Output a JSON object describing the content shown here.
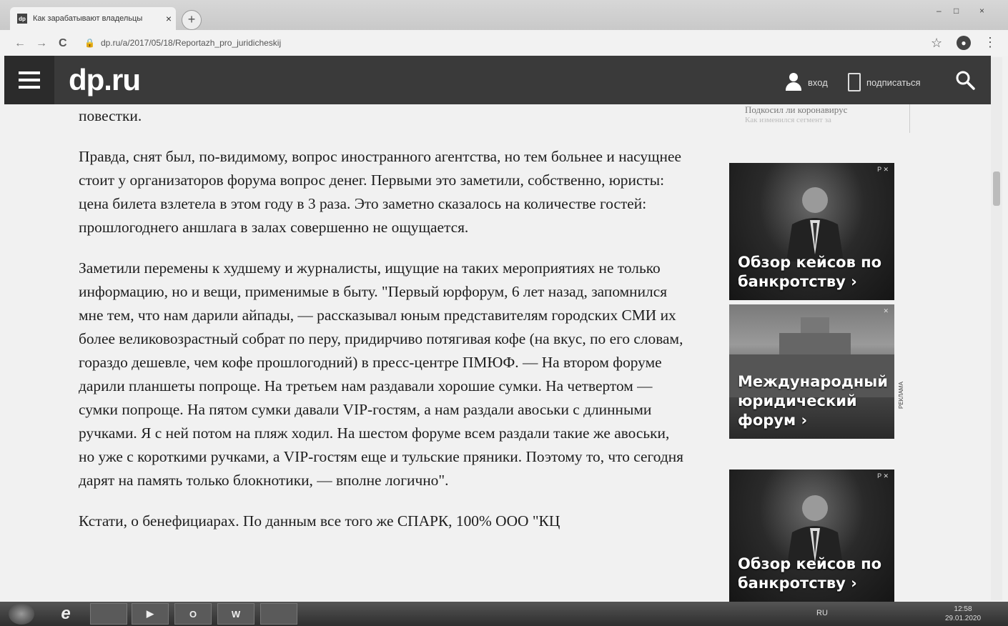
{
  "browser": {
    "tab_favicon": "dp",
    "tab_title": "Как зарабатывают владельцы",
    "tab_close": "×",
    "new_tab": "+",
    "url": "dp.ru/a/2017/05/18/Reportazh_pro_juridicheskij",
    "back": "←",
    "forward": "→",
    "reload": "C",
    "lock": "🔒",
    "star": "☆",
    "profile": "●",
    "menu": "⋮",
    "minimize": "–",
    "maximize": "□",
    "close": "×"
  },
  "site": {
    "logo": "dp.ru",
    "login": "вход",
    "subscribe": "подписаться"
  },
  "article": {
    "paragraphs": [
      "повестки.",
      "Правда, снят был, по-видимому, вопрос иностранного агентства, но тем больнее и насущнее стоит у организаторов форума вопрос денег. Первыми это заметили, собственно, юристы: цена билета взлетела в этом году в 3 раза. Это заметно сказалось на количестве гостей: прошлогоднего аншлага в залах совершенно не ощущается.",
      "Заметили перемены к худшему и журналисты, ищущие на таких мероприятиях не только информацию, но и вещи, применимые в быту. \"Первый юрфорум, 6 лет назад, запомнился мне тем, что нам дарили айпады, — рассказывал юным представителям городских СМИ их более великовозрастный собрат по перу, придирчиво потягивая кофе (на вкус, по его словам, гораздо дешевле, чем кофе прошлогодний) в пресс-центре ПМЮФ. — На втором форуме дарили планшеты попроще. На третьем нам раздавали хорошие сумки. На четвертом — сумки попроще. На пятом сумки давали VIP-гостям, а нам раздали авоськи с длинными ручками. Я с ней потом на пляж ходил. На шестом форуме всем раздали такие же авоськи, но уже с короткими ручками, а VIP-гостям еще и тульские пряники. Поэтому то, что сегодня дарят на память только блокнотики, — вполне логично\".",
      "Кстати, о бенефициарах. По данным все того же СПАРК, 100% ООО \"КЦ"
    ]
  },
  "sidebar": {
    "top_title": "Подкосил ли коронавирус",
    "top_sub": "Как изменился сегмент за",
    "ads": [
      {
        "label": "Обзор кейсов по банкротству ›",
        "mark": "P ✕"
      },
      {
        "label": "Международный юридический форум ›",
        "mark": "✕"
      },
      {
        "label": "Обзор кейсов по банкротству ›",
        "mark": "P ✕"
      }
    ],
    "reklama": "РЕКЛАМА"
  },
  "taskbar": {
    "apps": [
      "e",
      "",
      "▶",
      "O",
      "W",
      ""
    ],
    "lang": "RU",
    "time": "12:58",
    "date": "29.01.2020"
  }
}
